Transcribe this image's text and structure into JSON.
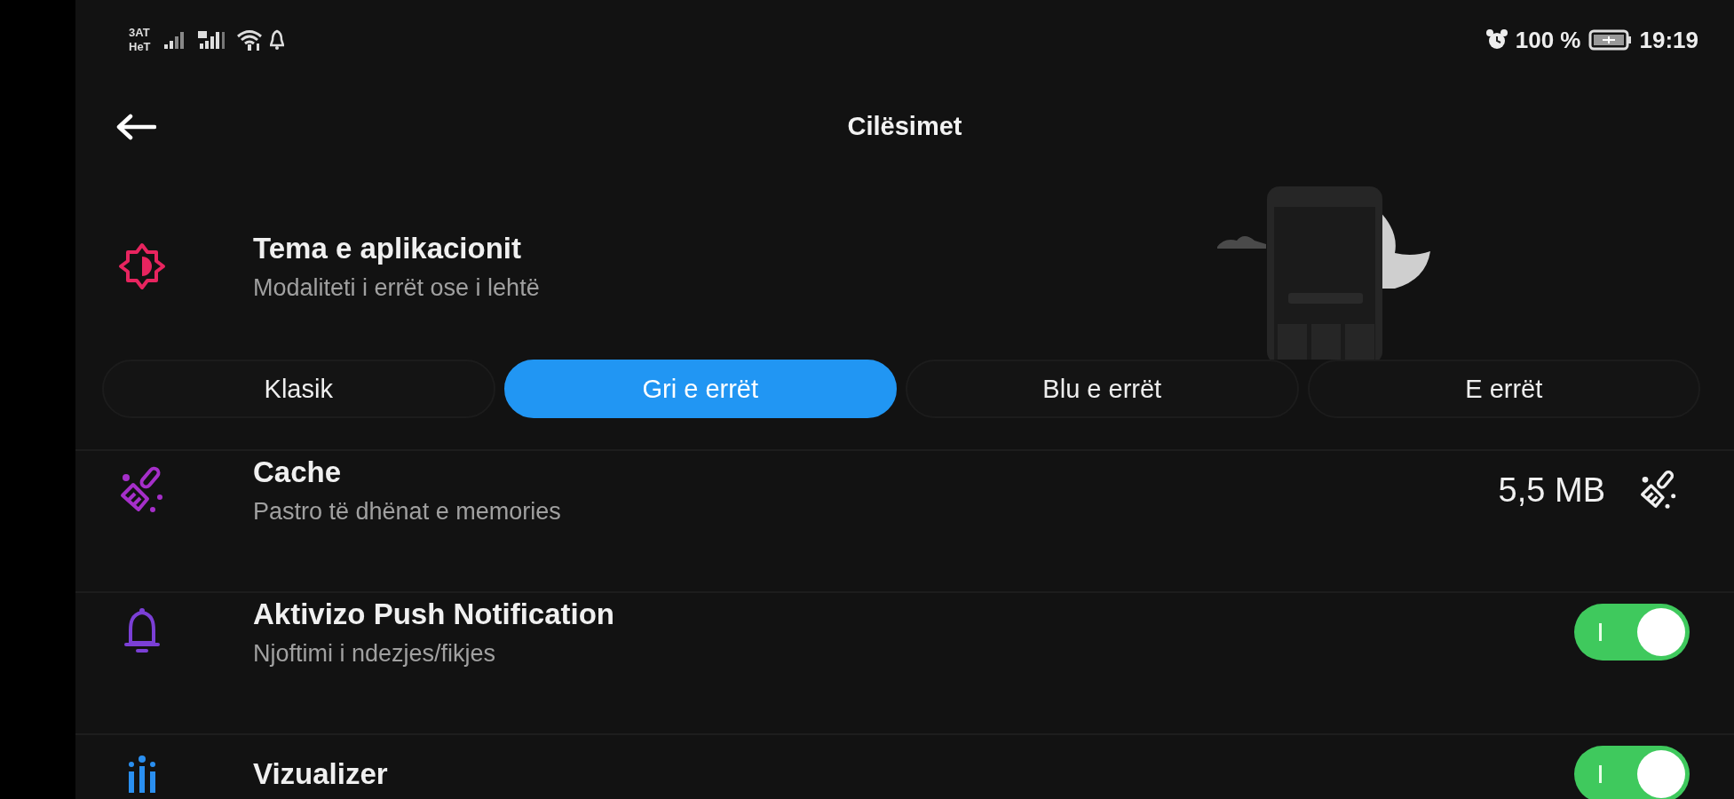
{
  "status_bar": {
    "carrier_lines": [
      "3AT",
      "HeT"
    ],
    "battery_percent": "100 %",
    "time": "19:19"
  },
  "header": {
    "title": "Cilësimet"
  },
  "theme": {
    "title": "Tema e aplikacionit",
    "subtitle": "Modaliteti i errët ose i lehtë",
    "options": [
      {
        "label": "Klasik",
        "selected": false
      },
      {
        "label": "Gri e errët",
        "selected": true
      },
      {
        "label": "Blu e errët",
        "selected": false
      },
      {
        "label": "E errët",
        "selected": false
      }
    ]
  },
  "settings": [
    {
      "kind": "action",
      "title": "Cache",
      "subtitle": "Pastro të dhënat e memories",
      "value": "5,5 MB"
    },
    {
      "kind": "toggle",
      "title": "Aktivizo Push Notification",
      "subtitle": "Njoftimi i ndezjes/fikjes",
      "on": true
    },
    {
      "kind": "toggle",
      "title": "Vizualizer",
      "on": true
    }
  ]
}
